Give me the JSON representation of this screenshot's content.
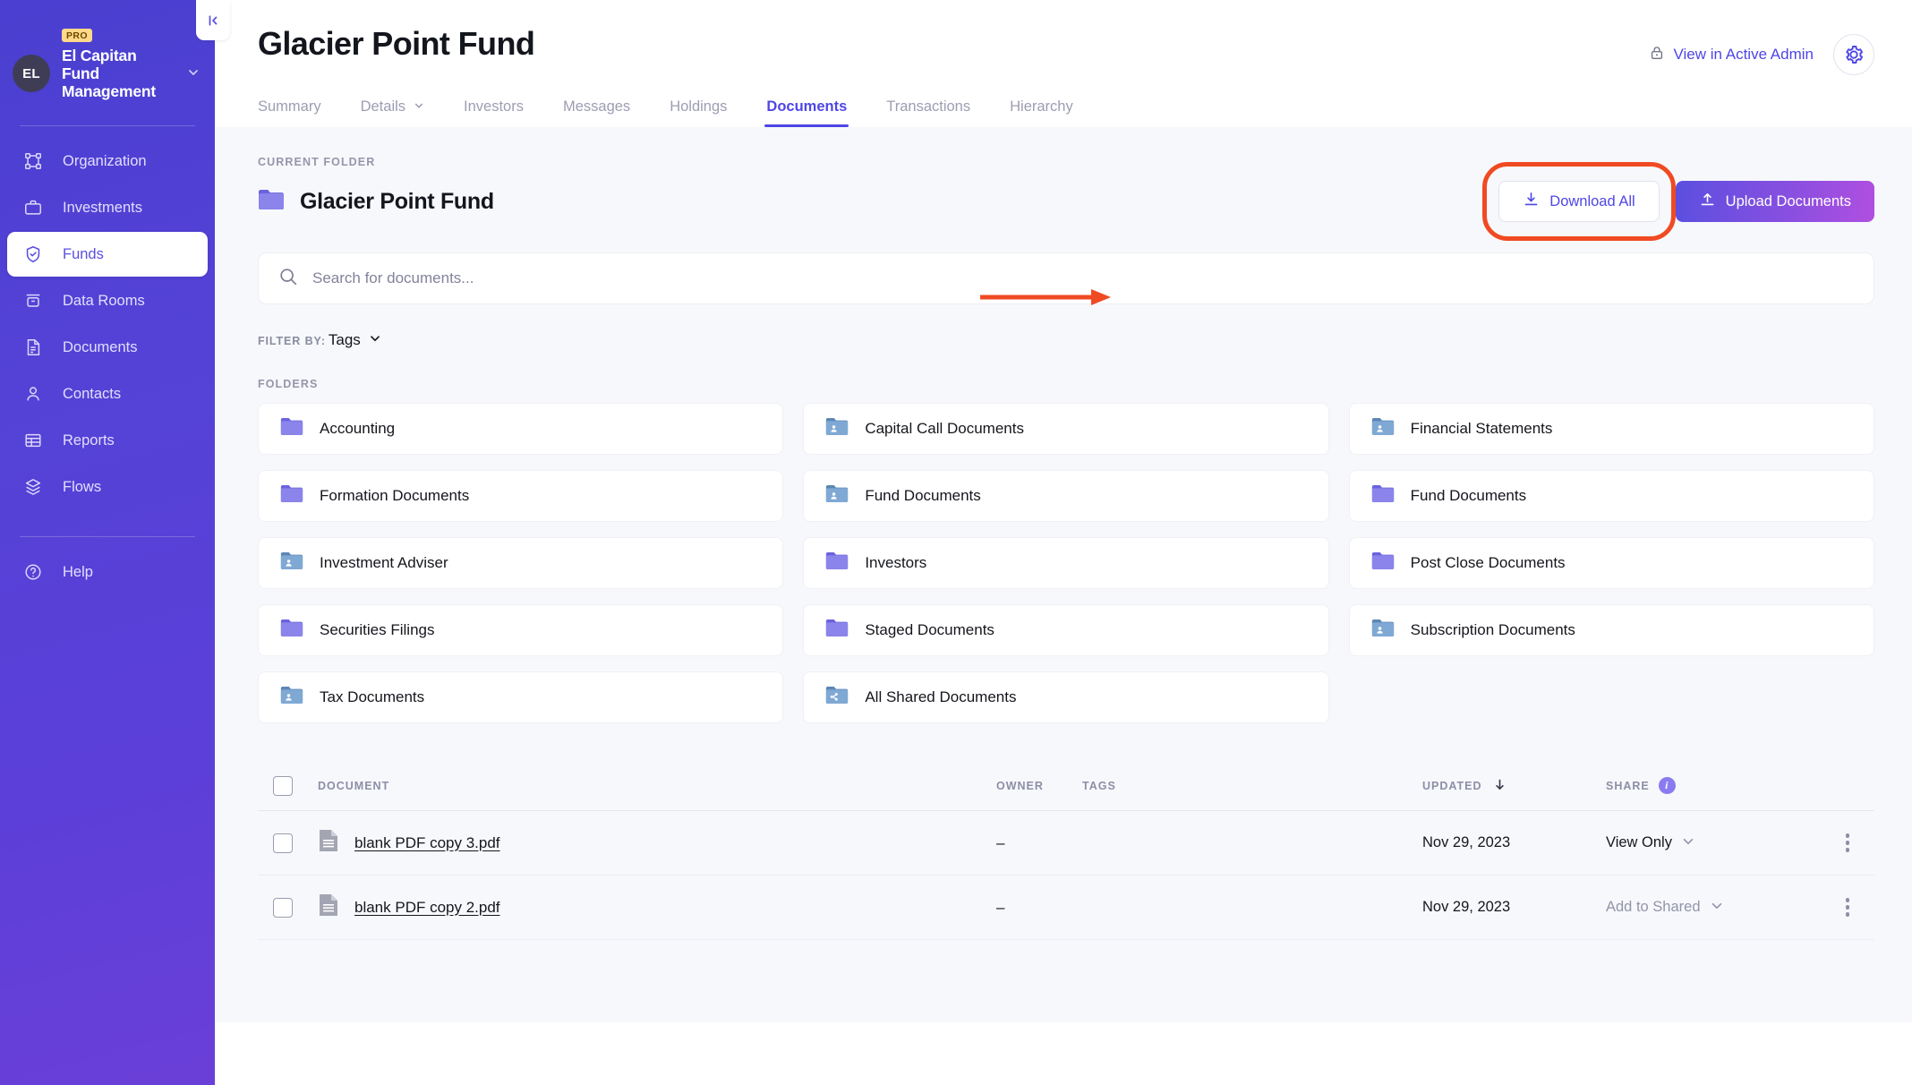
{
  "sidebar": {
    "badge": "PRO",
    "avatar_initials": "EL",
    "org_name": "El Capitan Fund Management",
    "items": [
      {
        "label": "Organization",
        "icon": "organization-icon"
      },
      {
        "label": "Investments",
        "icon": "briefcase-icon"
      },
      {
        "label": "Funds",
        "icon": "shield-check-icon"
      },
      {
        "label": "Data Rooms",
        "icon": "data-room-icon"
      },
      {
        "label": "Documents",
        "icon": "document-icon"
      },
      {
        "label": "Contacts",
        "icon": "person-icon"
      },
      {
        "label": "Reports",
        "icon": "table-icon"
      },
      {
        "label": "Flows",
        "icon": "layers-icon"
      }
    ],
    "help": {
      "label": "Help",
      "icon": "question-circle-icon"
    },
    "collapse_glyph": "|‹"
  },
  "header": {
    "title": "Glacier Point Fund",
    "admin_link": "View in Active Admin",
    "tabs": [
      {
        "label": "Summary",
        "has_caret": false,
        "active": false
      },
      {
        "label": "Details",
        "has_caret": true,
        "active": false
      },
      {
        "label": "Investors",
        "has_caret": false,
        "active": false
      },
      {
        "label": "Messages",
        "has_caret": false,
        "active": false
      },
      {
        "label": "Holdings",
        "has_caret": false,
        "active": false
      },
      {
        "label": "Documents",
        "has_caret": false,
        "active": true
      },
      {
        "label": "Transactions",
        "has_caret": false,
        "active": false
      },
      {
        "label": "Hierarchy",
        "has_caret": false,
        "active": false
      }
    ]
  },
  "folder_header": {
    "eyebrow": "CURRENT FOLDER",
    "name": "Glacier Point Fund",
    "download_all": "Download All",
    "upload_documents": "Upload Documents"
  },
  "search": {
    "placeholder": "Search for documents...",
    "value": ""
  },
  "filter": {
    "label": "FILTER BY:",
    "value": "Tags"
  },
  "folders": {
    "label": "FOLDERS",
    "items": [
      {
        "name": "Accounting",
        "type": "private"
      },
      {
        "name": "Capital Call Documents",
        "type": "shared"
      },
      {
        "name": "Financial Statements",
        "type": "shared"
      },
      {
        "name": "Formation Documents",
        "type": "private"
      },
      {
        "name": "Fund Documents",
        "type": "shared"
      },
      {
        "name": "Fund Documents",
        "type": "private"
      },
      {
        "name": "Investment Adviser",
        "type": "shared"
      },
      {
        "name": "Investors",
        "type": "private"
      },
      {
        "name": "Post Close Documents",
        "type": "private"
      },
      {
        "name": "Securities Filings",
        "type": "private"
      },
      {
        "name": "Staged Documents",
        "type": "private"
      },
      {
        "name": "Subscription Documents",
        "type": "shared"
      },
      {
        "name": "Tax Documents",
        "type": "shared"
      },
      {
        "name": "All Shared Documents",
        "type": "all-shared"
      }
    ]
  },
  "table": {
    "columns": {
      "document": "DOCUMENT",
      "owner": "OWNER",
      "tags": "TAGS",
      "updated": "UPDATED",
      "share": "SHARE"
    },
    "rows": [
      {
        "name": "blank PDF copy 3.pdf",
        "owner": "–",
        "tags": "",
        "updated": "Nov 29, 2023",
        "share": "View Only",
        "share_muted": false
      },
      {
        "name": "blank PDF copy 2.pdf",
        "owner": "–",
        "tags": "",
        "updated": "Nov 29, 2023",
        "share": "Add to Shared",
        "share_muted": true
      }
    ]
  },
  "colors": {
    "brand_purple": "#4f46e5",
    "sidebar_purple": "#5442d6",
    "annotation_red": "#f04a23",
    "folder_private": "#8b84ea",
    "folder_shared": "#7fa9d4",
    "pro_badge": "#ffd98a"
  }
}
